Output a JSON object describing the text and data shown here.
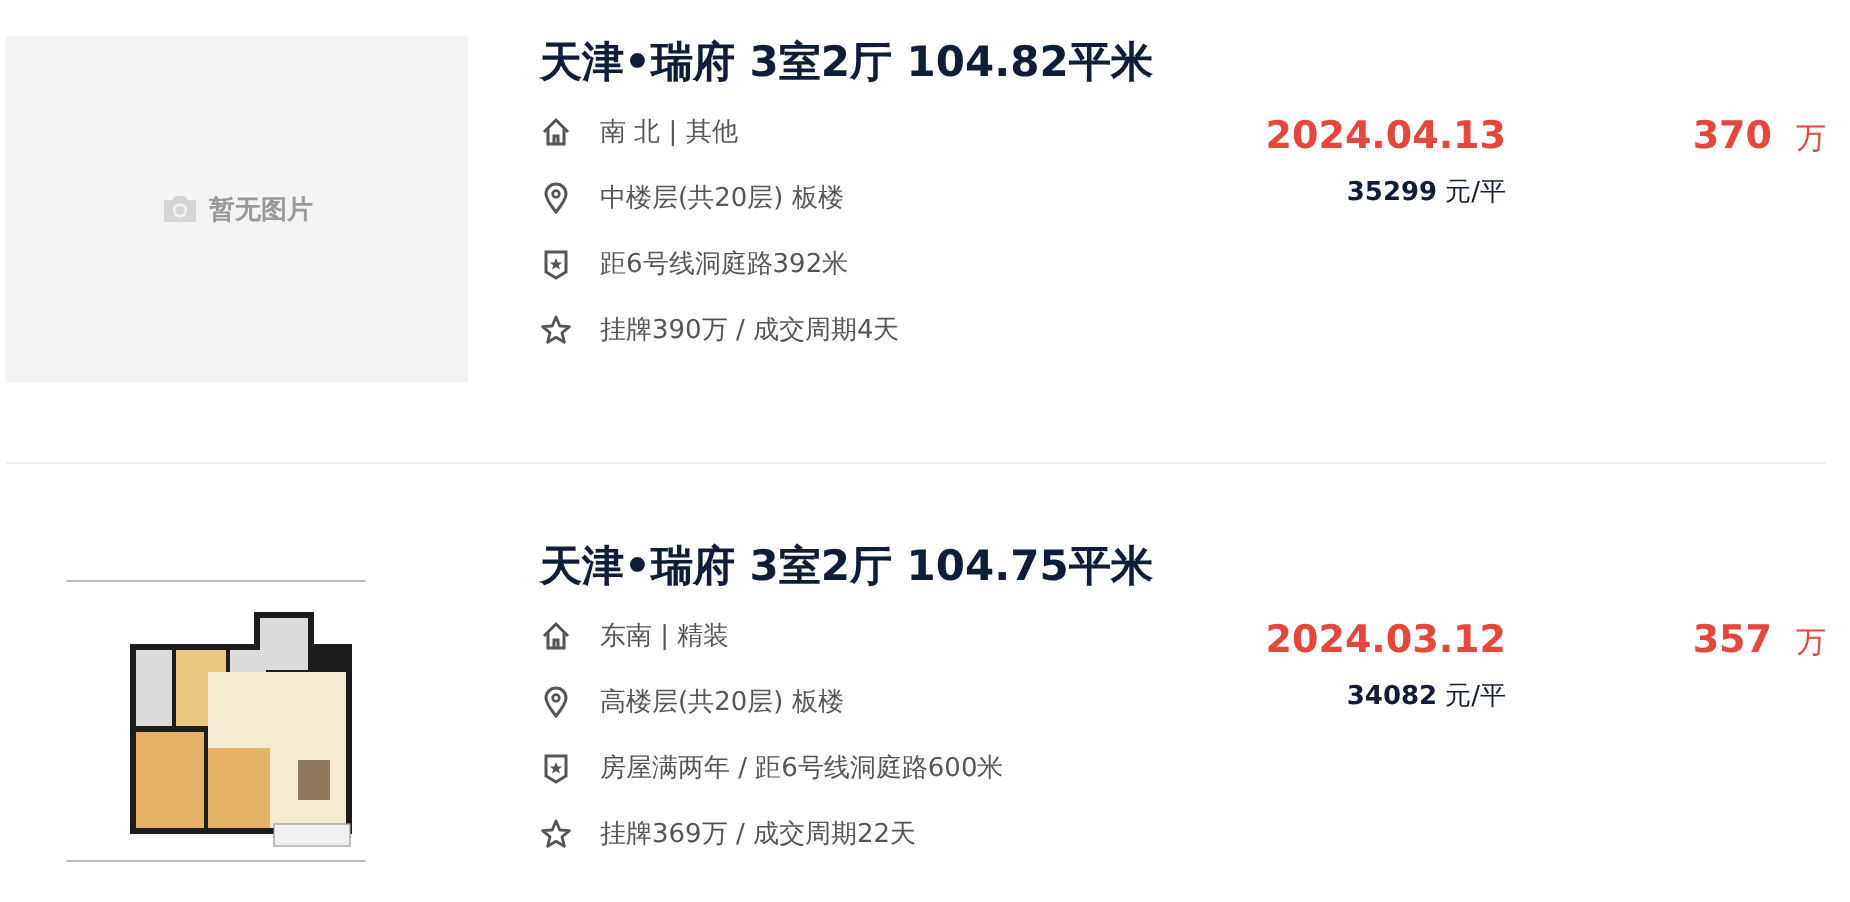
{
  "listings": [
    {
      "image": {
        "kind": "placeholder",
        "text": "暂无图片"
      },
      "title": "天津•瑞府 3室2厅 104.82平米",
      "details": [
        {
          "kind": "house",
          "text": "南 北 | 其他"
        },
        {
          "kind": "location",
          "text": "中楼层(共20层) 板楼"
        },
        {
          "kind": "badge",
          "text": "距6号线洞庭路392米"
        },
        {
          "kind": "star",
          "text": "挂牌390万 / 成交周期4天"
        }
      ],
      "deal_date": "2024.04.13",
      "unit_price": {
        "value": "35299",
        "unit": "元/平"
      },
      "total_price": {
        "value": "370",
        "unit": "万"
      }
    },
    {
      "title": "天津•瑞府 3室2厅 104.75平米",
      "details": [
        {
          "kind": "house",
          "text": "东南 | 精装"
        },
        {
          "kind": "location",
          "text": "高楼层(共20层) 板楼"
        },
        {
          "kind": "badge",
          "text": "房屋满两年 / 距6号线洞庭路600米"
        },
        {
          "kind": "star",
          "text": "挂牌369万 / 成交周期22天"
        }
      ],
      "deal_date": "2024.03.12",
      "unit_price": {
        "value": "34082",
        "unit": "元/平"
      },
      "total_price": {
        "value": "357",
        "unit": "万"
      }
    }
  ]
}
